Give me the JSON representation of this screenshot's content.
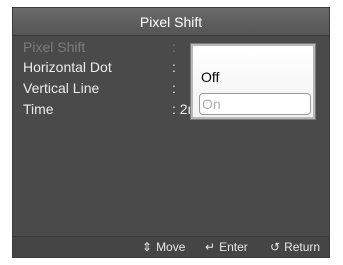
{
  "title": "Pixel Shift",
  "menu": [
    {
      "label": "Pixel Shift",
      "separator": ":",
      "value": "",
      "enabled": false
    },
    {
      "label": "Horizontal Dot",
      "separator": ":",
      "value": "",
      "enabled": true
    },
    {
      "label": "Vertical Line",
      "separator": ":",
      "value": "",
      "enabled": true
    },
    {
      "label": "Time",
      "separator": ":",
      "value": "2min",
      "enabled": true
    }
  ],
  "popup": {
    "options": [
      "Off",
      "On"
    ],
    "selected": "On"
  },
  "footer": {
    "move": {
      "icon": "up-down-arrow-icon",
      "glyph": "⇕",
      "label": "Move"
    },
    "enter": {
      "icon": "enter-icon",
      "glyph": "↵",
      "label": "Enter"
    },
    "return": {
      "icon": "return-icon",
      "glyph": "↺",
      "label": "Return"
    }
  }
}
